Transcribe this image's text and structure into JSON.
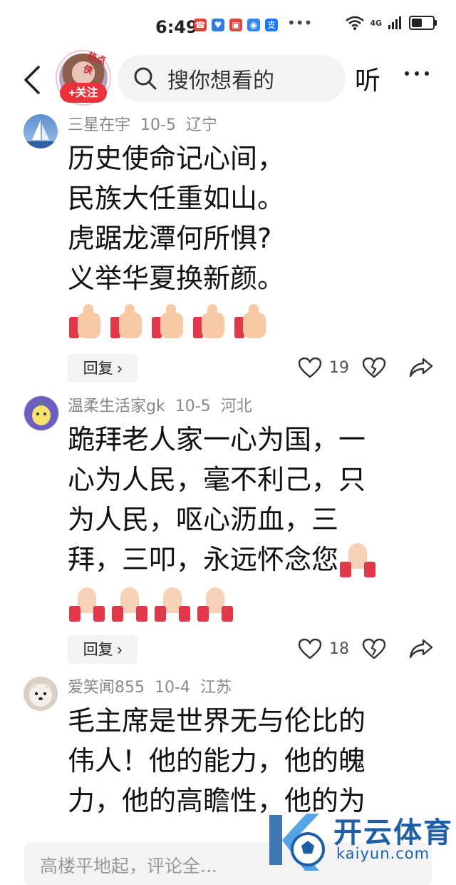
{
  "status": {
    "time": "6:49",
    "network": "4G",
    "app_icons": [
      {
        "name": "app-icon",
        "color": "#e2433b",
        "glyph": "☎"
      },
      {
        "name": "app-icon",
        "color": "#2f7ce3",
        "glyph": "♥"
      },
      {
        "name": "app-icon",
        "color": "#e2433b",
        "glyph": "▣"
      },
      {
        "name": "app-icon",
        "color": "#2f86f0",
        "glyph": "◉"
      },
      {
        "name": "alipay-icon",
        "color": "#1677ff",
        "glyph": "支"
      }
    ],
    "more": "•••"
  },
  "header": {
    "follow_label": "+关注",
    "avatar_tag": "热点侠",
    "search_placeholder": "搜你想看的",
    "listen_label": "听"
  },
  "comments": [
    {
      "user": "三星在宇",
      "date": "10-5",
      "region": "辽宁",
      "lines": [
        "历史使命记心间，",
        "民族大任重如山。",
        "虎踞龙潭何所惧?",
        "义举华夏换新颜。"
      ],
      "emoji": "thumbs-up",
      "emoji_count": 5,
      "reply_label": "回复 ›",
      "likes": "19"
    },
    {
      "user": "温柔生活家gk",
      "date": "10-5",
      "region": "河北",
      "lines": [
        "跪拜老人家一心为国，一",
        "心为人民，毫不利己，只",
        "为人民，呕心沥血，三",
        "拜，三叩，永远怀念您"
      ],
      "emoji": "folded-hands",
      "emoji_count": 5,
      "reply_label": "回复 ›",
      "likes": "18"
    },
    {
      "user": "爱笑闻855",
      "date": "10-4",
      "region": "江苏",
      "lines": [
        "毛主席是世界无与伦比的",
        "伟人！他的能力，他的魄",
        "力，他的高瞻性，他的为"
      ]
    }
  ],
  "bottom": {
    "comment_placeholder": "高楼平地起，评论全..."
  },
  "watermark": {
    "title": "开云体育",
    "domain": "kaiyun.com"
  },
  "colors": {
    "accent": "#e8333a",
    "meta": "#888888",
    "watermark": "#1e5fa8"
  }
}
